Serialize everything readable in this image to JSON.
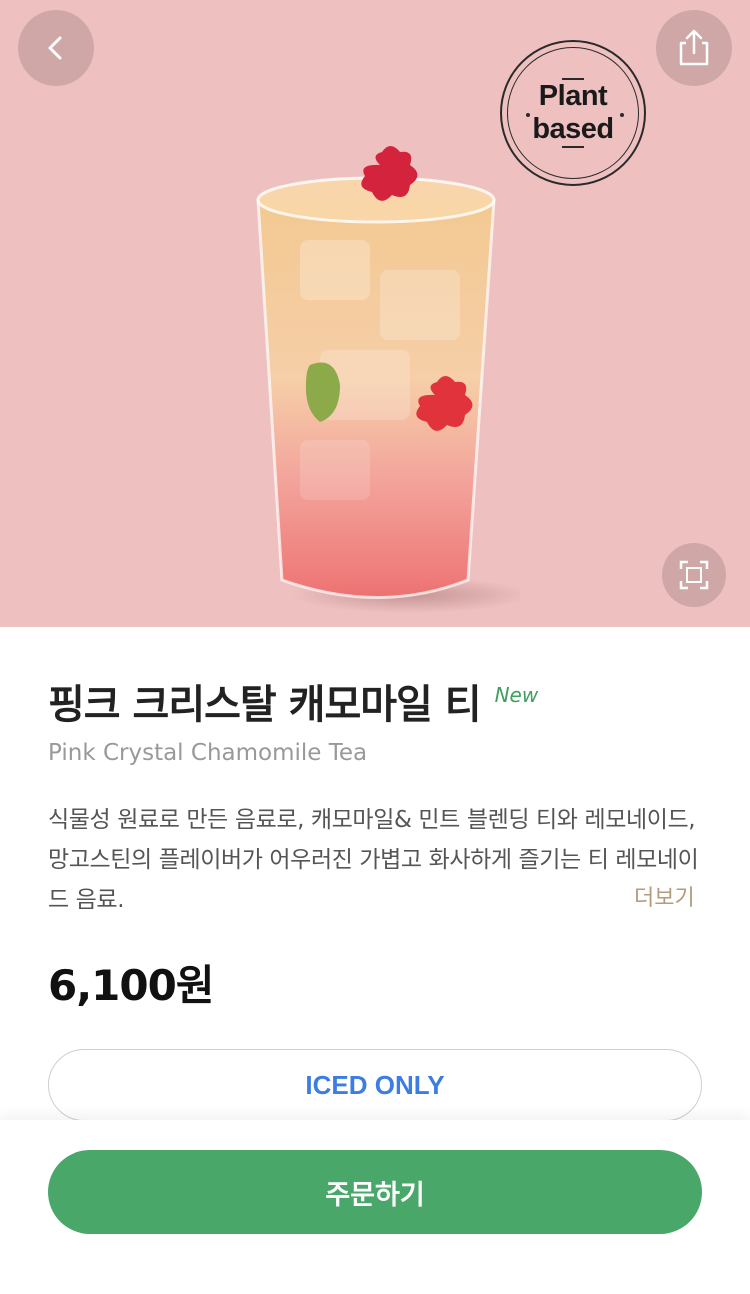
{
  "hero": {
    "badge": {
      "line1": "Plant",
      "line2": "based"
    },
    "icons": {
      "back": "chevron-left-icon",
      "share": "share-icon",
      "expand": "expand-icon"
    },
    "background_color": "#efc0c0"
  },
  "product": {
    "name_ko": "핑크 크리스탈 캐모마일 티",
    "new_tag": "New",
    "name_en": "Pink Crystal Chamomile Tea",
    "description": "식물성 원료로 만든 음료로, 캐모마일& 민트 블렌딩 티와 레모네이드, 망고스틴의 플레이버가 어우러진 가볍고 화사하게 즐기는 티 레모네이드 음료.",
    "more_label": "더보기",
    "price": "6,100원"
  },
  "options": {
    "temperature_label": "ICED ONLY"
  },
  "footer": {
    "order_label": "주문하기"
  },
  "colors": {
    "accent_green": "#4aa76a",
    "new_green": "#3e9f5e",
    "iced_blue": "#3b7de3",
    "more_brown": "#b39c7d"
  }
}
